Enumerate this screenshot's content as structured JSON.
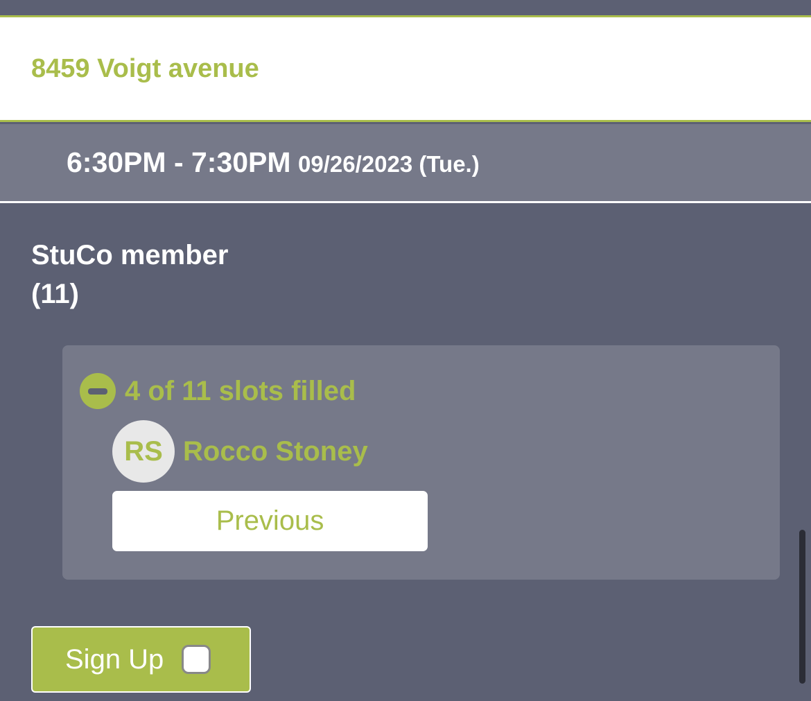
{
  "location": {
    "address": "8459 Voigt avenue"
  },
  "timeslot": {
    "time_range": "6:30PM - 7:30PM",
    "date": "09/26/2023 (Tue.)"
  },
  "role": {
    "title": "StuCo member",
    "count": "(11)"
  },
  "slots": {
    "summary": "4 of 11 slots filled",
    "toggle_icon": "minus-circle-icon",
    "filled_members": [
      {
        "initials": "RS",
        "name": "Rocco Stoney"
      }
    ],
    "previous_label": "Previous"
  },
  "signup": {
    "label": "Sign Up",
    "checked": false
  },
  "colors": {
    "accent": "#a9bd4b",
    "background": "#5c6073",
    "panel": "#767989",
    "white": "#ffffff"
  }
}
